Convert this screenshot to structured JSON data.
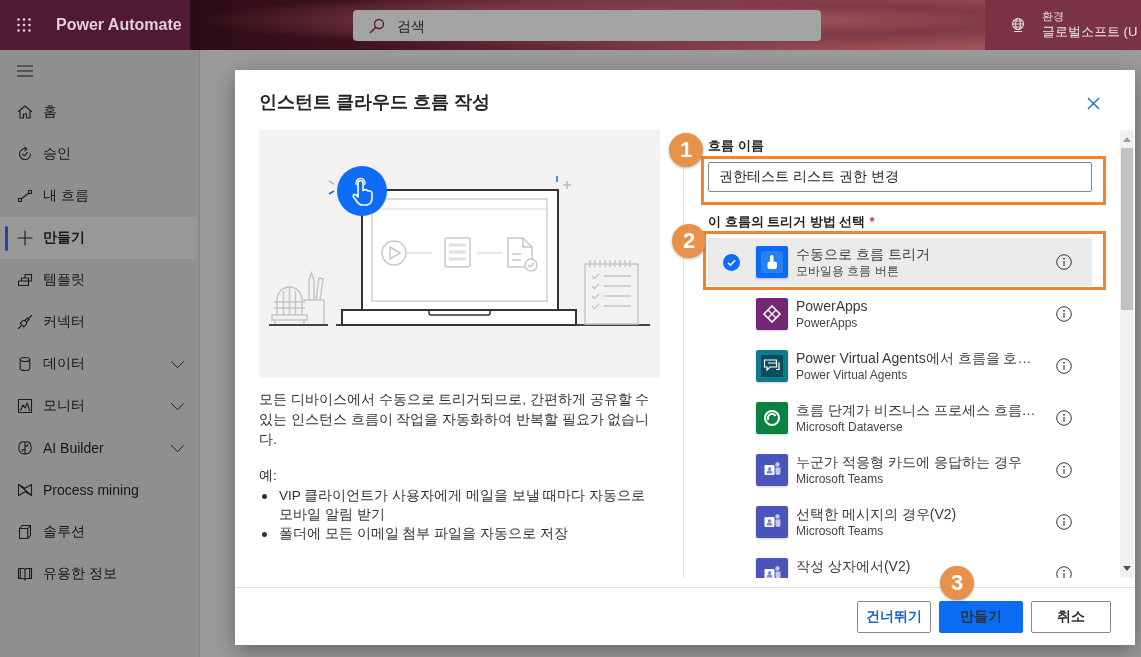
{
  "header": {
    "app_name": "Power Automate",
    "search": {
      "placeholder": "검색"
    },
    "environment": {
      "label": "환경",
      "value": "글로벌소프트 (U"
    }
  },
  "sidebar": {
    "items": [
      {
        "label": "홈",
        "kind": "link",
        "selected": false
      },
      {
        "label": "승인",
        "kind": "link",
        "selected": false
      },
      {
        "label": "내 흐름",
        "kind": "link",
        "selected": false
      },
      {
        "label": "만들기",
        "kind": "link",
        "selected": true
      },
      {
        "label": "템플릿",
        "kind": "link",
        "selected": false
      },
      {
        "label": "커넥터",
        "kind": "link",
        "selected": false
      },
      {
        "label": "데이터",
        "kind": "group",
        "selected": false
      },
      {
        "label": "모니터",
        "kind": "group",
        "selected": false
      },
      {
        "label": "AI Builder",
        "kind": "group",
        "selected": false
      },
      {
        "label": "Process mining",
        "kind": "link",
        "selected": false
      },
      {
        "label": "솔루션",
        "kind": "link",
        "selected": false
      },
      {
        "label": "유용한 정보",
        "kind": "link",
        "selected": false
      }
    ]
  },
  "dialog": {
    "title": "인스턴트 클라우드 흐름 작성",
    "description": "모든 디바이스에서 수동으로 트리거되므로, 간편하게 공유할 수 있는 인스턴스 흐름이 작업을 자동화하여 반복할 필요가 없습니다.",
    "examples_label": "예:",
    "examples": [
      "VIP 클라이언트가 사용자에게 메일을 보낼 때마다 자동으로 모바일 알림 받기",
      "폴더에 모든 이메일 첨부 파일을 자동으로 저장"
    ],
    "name_field": {
      "label": "흐름 이름",
      "value": "권한테스트 리스트 권한 변경"
    },
    "trigger_field": {
      "label": "이 흐름의 트리거 방법 선택",
      "required_mark": "*"
    },
    "triggers": [
      {
        "title": "수동으로 흐름 트리거",
        "subtitle": "모바일용 흐름 버튼",
        "color": "#0a6cf5",
        "selected": true
      },
      {
        "title": "PowerApps",
        "subtitle": "PowerApps",
        "color": "#742774",
        "selected": false
      },
      {
        "title": "Power Virtual Agents에서 흐름을 호…",
        "subtitle": "Power Virtual Agents",
        "color": "#0f7b8a",
        "selected": false
      },
      {
        "title": "흐름 단계가 비즈니스 프로세스 흐름…",
        "subtitle": "Microsoft Dataverse",
        "color": "#0b8043",
        "selected": false
      },
      {
        "title": "누군가 적응형 카드에 응답하는 경우",
        "subtitle": "Microsoft Teams",
        "color": "#4b53bc",
        "selected": false
      },
      {
        "title": "선택한 메시지의 경우(V2)",
        "subtitle": "Microsoft Teams",
        "color": "#4b53bc",
        "selected": false
      },
      {
        "title": "작성 상자에서(V2)",
        "color": "#4b53bc",
        "selected": false
      }
    ],
    "buttons": [
      {
        "label": "건너뛰기",
        "kind": "outline"
      },
      {
        "label": "만들기",
        "kind": "primary"
      },
      {
        "label": "취소",
        "kind": "secondary"
      }
    ]
  },
  "annotations": [
    {
      "label": "1"
    },
    {
      "label": "2"
    },
    {
      "label": "3"
    }
  ]
}
